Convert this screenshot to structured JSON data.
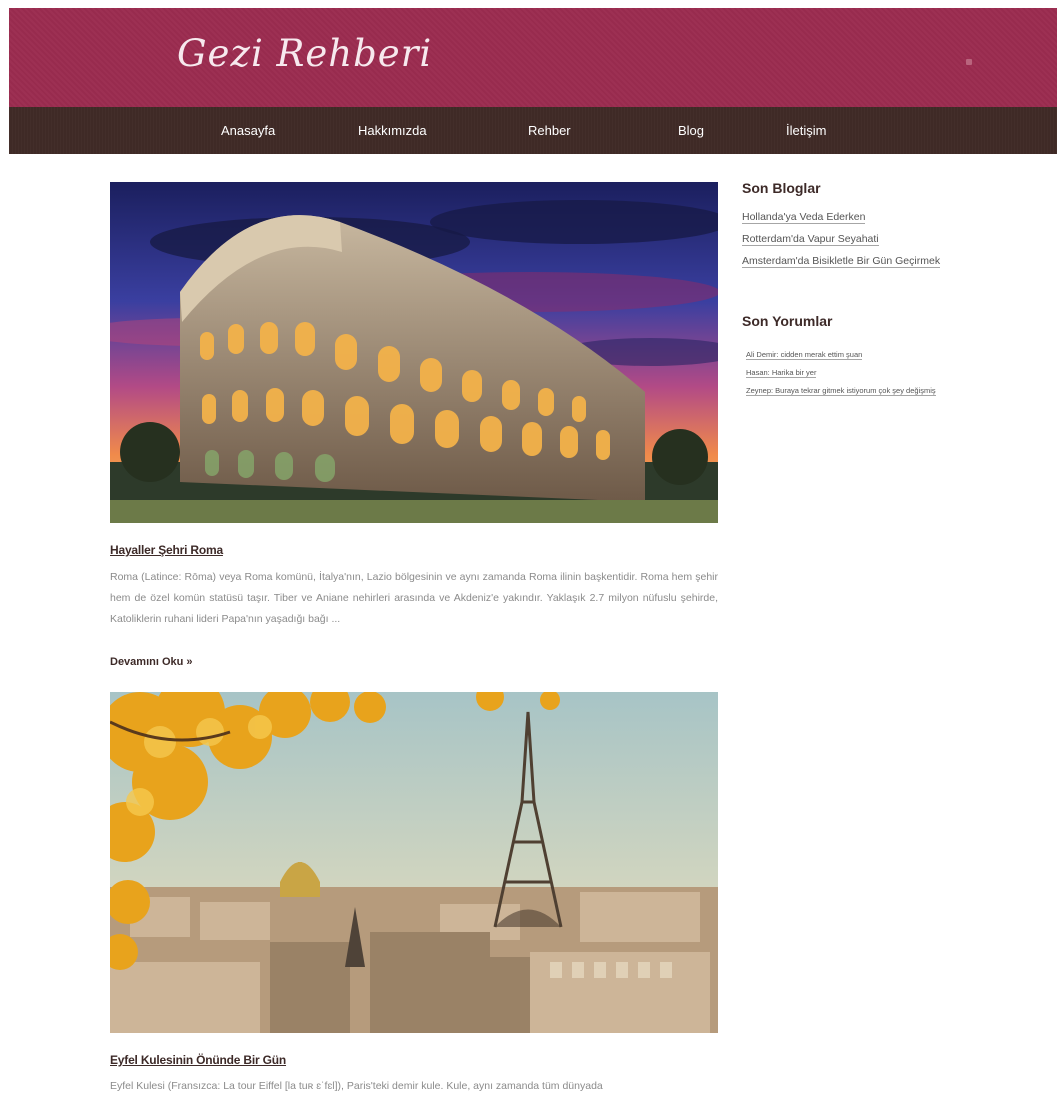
{
  "header": {
    "site_title": "Gezi Rehberi"
  },
  "nav": {
    "items": [
      {
        "label": "Anasayfa"
      },
      {
        "label": "Hakkımızda"
      },
      {
        "label": "Rehber"
      },
      {
        "label": "Blog"
      },
      {
        "label": "İletişim"
      }
    ]
  },
  "posts": [
    {
      "title": "Hayaller Şehri Roma",
      "excerpt": "Roma (Latince: Rōma) veya Roma komünü, İtalya'nın, Lazio bölgesinin ve aynı zamanda Roma ilinin başkentidir. Roma hem şehir hem de özel komün statüsü taşır. Tiber ve Aniane nehirleri arasında ve Akdeniz'e yakındır. Yaklaşık 2.7 milyon nüfuslu şehirde, Katoliklerin ruhani lideri Papa'nın yaşadığı bağı ...",
      "read_more": "Devamını Oku »",
      "image": "colosseum-photo"
    },
    {
      "title": "Eyfel Kulesinin Önünde Bir Gün",
      "excerpt": "Eyfel Kulesi (Fransızca: La tour Eiffel [la tuʀ ɛˈfɛl]), Paris'teki demir kule. Kule, aynı zamanda tüm dünyada",
      "image": "eiffel-tower-photo"
    }
  ],
  "sidebar": {
    "recent_blogs_heading": "Son Bloglar",
    "recent_blogs": [
      "Hollanda'ya Veda Ederken",
      "Rotterdam'da Vapur Seyahati",
      "Amsterdam'da Bisikletle Bir Gün Geçirmek"
    ],
    "recent_comments_heading": "Son Yorumlar",
    "recent_comments": [
      "Ali Demir: cidden merak ettim şuan",
      "Hasan: Harika bir yer",
      "Zeynep: Buraya tekrar gitmek istiyorum çok şey değişmiş"
    ]
  },
  "colors": {
    "header_bg": "#9b2c50",
    "nav_bg": "#3f2a26",
    "title_text": "#3d2a28",
    "body_text": "#8b8b8b"
  }
}
